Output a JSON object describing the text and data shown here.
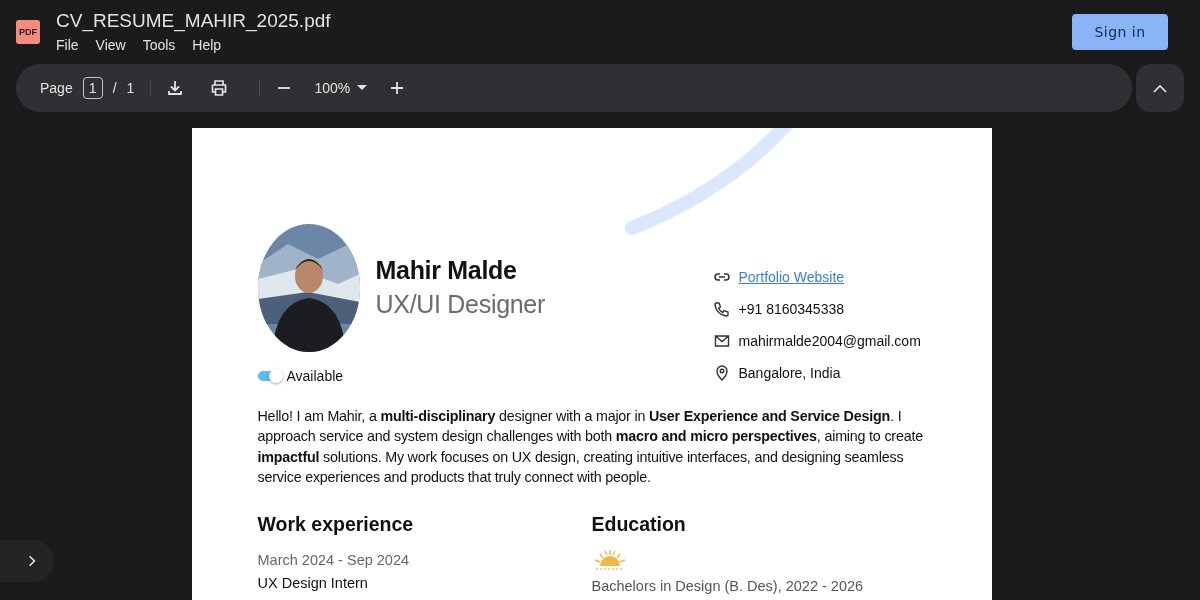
{
  "window": {
    "file_badge": "PDF",
    "title": "CV_RESUME_MAHIR_2025.pdf",
    "menu": [
      "File",
      "View",
      "Tools",
      "Help"
    ],
    "sign_in": "Sign in"
  },
  "toolbar": {
    "page_label": "Page",
    "page_value": "1",
    "page_separator": "/",
    "page_count": "1",
    "zoom": "100%"
  },
  "resume": {
    "name": "Mahir Malde",
    "role": "UX/UI Designer",
    "available": {
      "label": "Available",
      "on": true
    },
    "contacts": [
      {
        "kind": "link",
        "text": "Portfolio Website"
      },
      {
        "kind": "phone",
        "text": "+91 8160345338"
      },
      {
        "kind": "email",
        "text": "mahirmalde2004@gmail.com"
      },
      {
        "kind": "location",
        "text": "Bangalore, India"
      }
    ],
    "summary": "Hello! I am Mahir, a **multi-disciplinary** designer with a major in **User Experience and Service Design**. I approach service and system design challenges with both **macro and micro perspectives**, aiming to create **impactful** solutions. My work focuses on UX design, creating intuitive interfaces, and designing seamless service experiences and products that truly connect with people.",
    "work": {
      "heading": "Work experience",
      "entries": [
        {
          "dates": "March 2024 - Sep 2024",
          "title": "UX Design Intern"
        }
      ]
    },
    "education": {
      "heading": "Education",
      "entries": [
        {
          "degree": "Bachelors in Design (B. Des), 2022 - 2026"
        }
      ]
    }
  }
}
